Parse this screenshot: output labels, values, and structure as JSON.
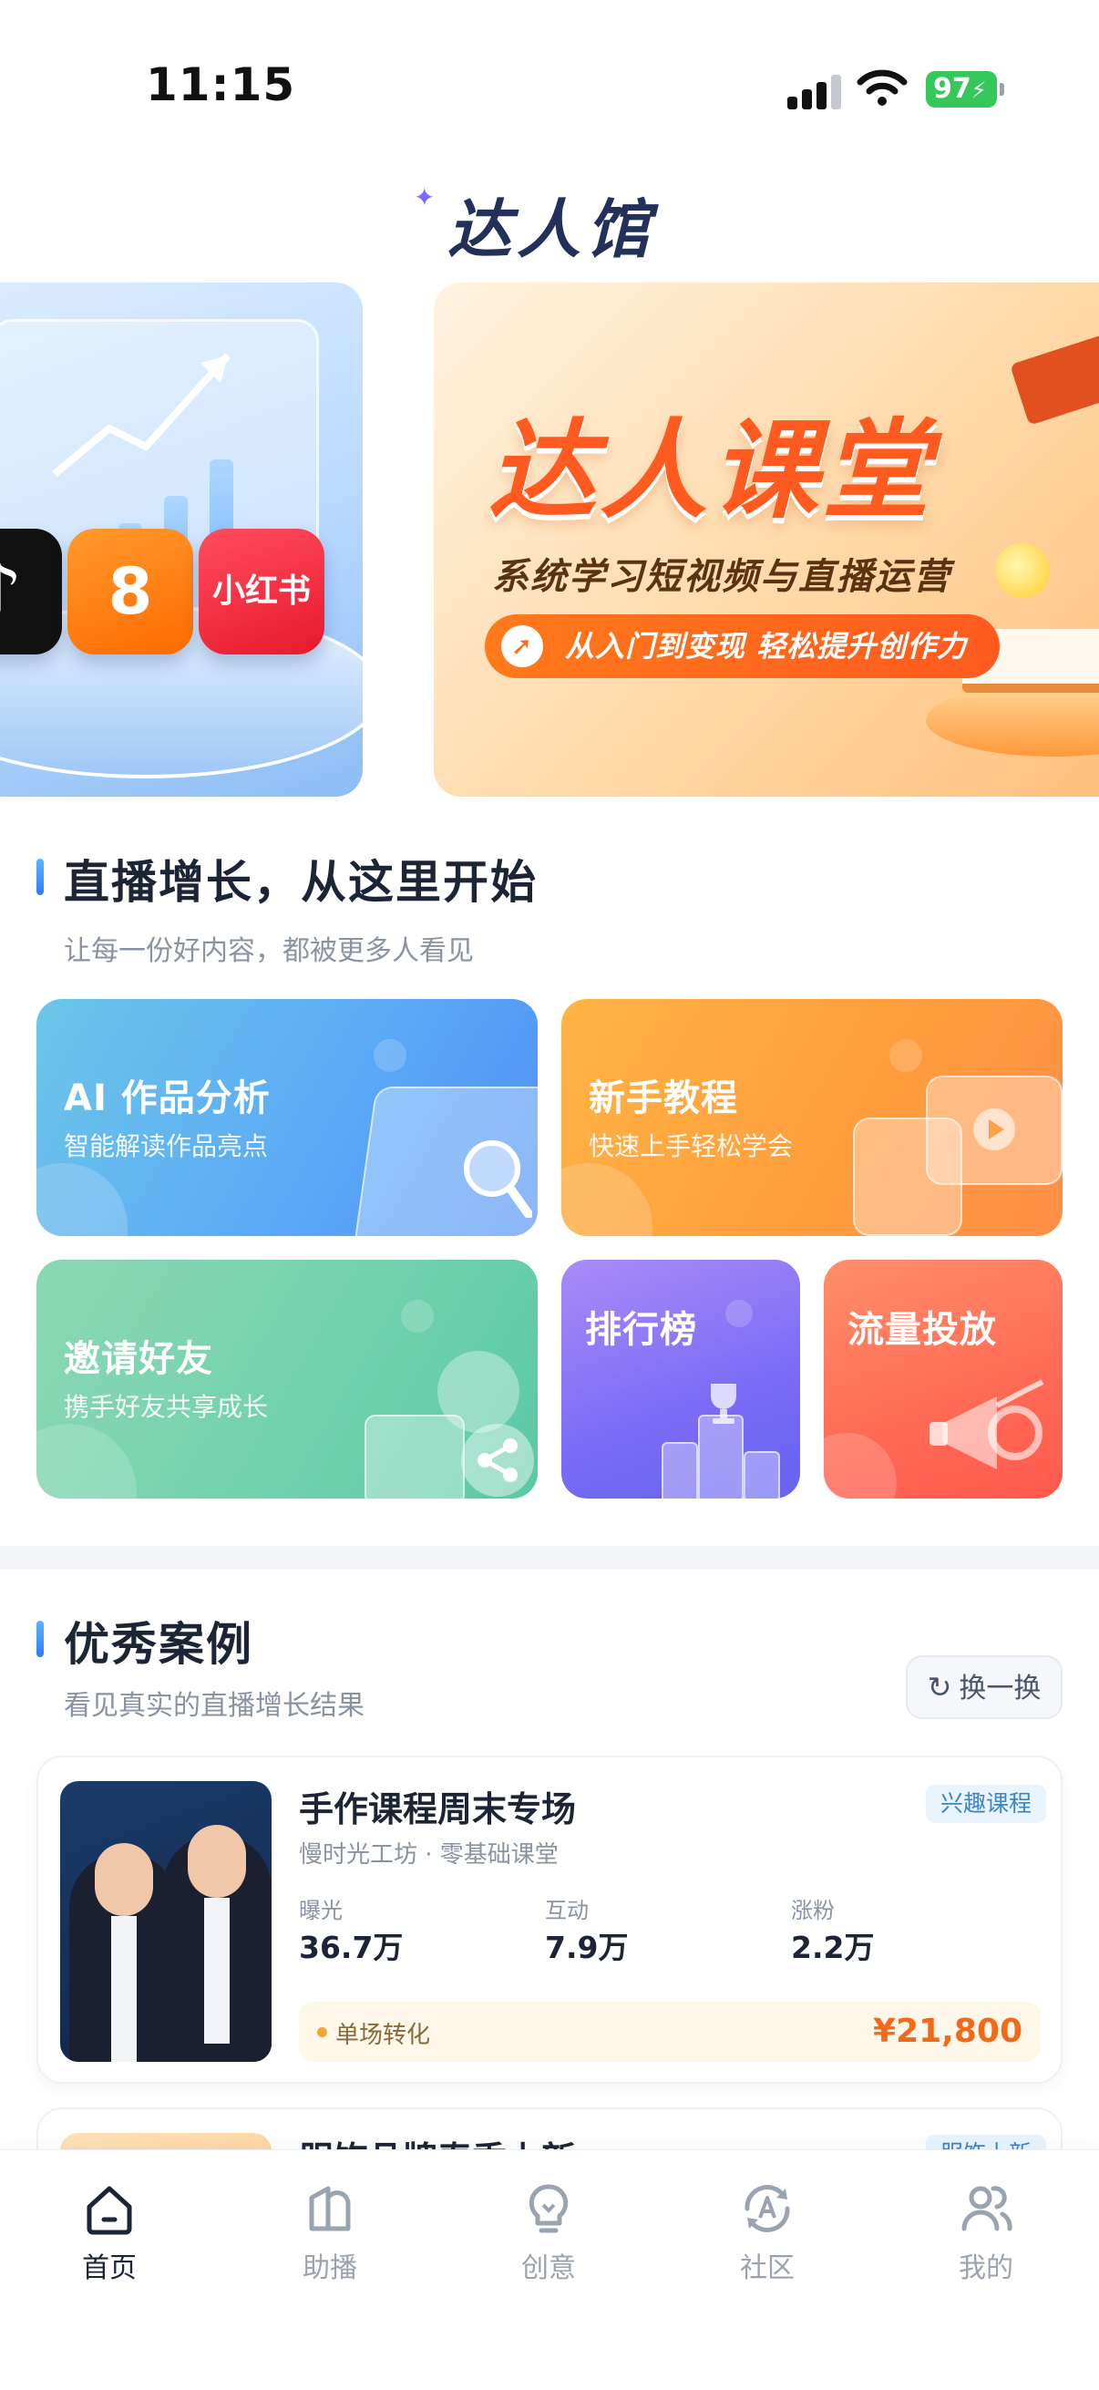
{
  "status_bar": {
    "time": "11:15",
    "battery": "97"
  },
  "logo": {
    "text": "达人馆"
  },
  "banners": {
    "left": {
      "apps": [
        "♪",
        "8",
        "小红书"
      ]
    },
    "right": {
      "title": "达人课堂",
      "subtitle": "系统学习短视频与直播运营",
      "pill": "从入门到变现 轻松提升创作力"
    }
  },
  "growth_section": {
    "title": "直播增长，从这里开始",
    "subtitle": "让每一份好内容，都被更多人看见"
  },
  "features": [
    {
      "title": "AI 作品分析",
      "subtitle": "智能解读作品亮点",
      "color": "#5aa8f7"
    },
    {
      "title": "新手教程",
      "subtitle": "快速上手轻松学会",
      "color": "#ff9c3d"
    },
    {
      "title": "邀请好友",
      "subtitle": "携手好友共享成长",
      "color": "#6fd1ae"
    },
    {
      "title": "排行榜",
      "color": "#7b6cf5"
    },
    {
      "title": "流量投放",
      "color": "#ff6a55"
    }
  ],
  "cases_section": {
    "title": "优秀案例",
    "subtitle": "看见真实的直播增长结果",
    "refresh_label": "换一换"
  },
  "cases": [
    {
      "title": "手作课程周末专场",
      "tag": "兴趣课程",
      "meta": "慢时光工坊 · 零基础课堂",
      "stats": [
        {
          "label": "曝光",
          "value": "36.7万"
        },
        {
          "label": "互动",
          "value": "7.9万"
        },
        {
          "label": "涨粉",
          "value": "2.2万"
        }
      ],
      "conversion_label": "单场转化",
      "conversion_value": "¥21,800"
    },
    {
      "title": "服饰品牌春季上新",
      "tag": "服饰上新"
    }
  ],
  "tab_bar": [
    {
      "label": "首页",
      "icon": "home-icon",
      "active": true
    },
    {
      "label": "助播",
      "icon": "assist-icon",
      "active": false
    },
    {
      "label": "创意",
      "icon": "lightbulb-icon",
      "active": false
    },
    {
      "label": "社区",
      "icon": "community-icon",
      "active": false
    },
    {
      "label": "我的",
      "icon": "profile-icon",
      "active": false
    }
  ],
  "colors": {
    "accent": "#2f7cf6",
    "price": "#f06a1a",
    "battery": "#35c759"
  }
}
